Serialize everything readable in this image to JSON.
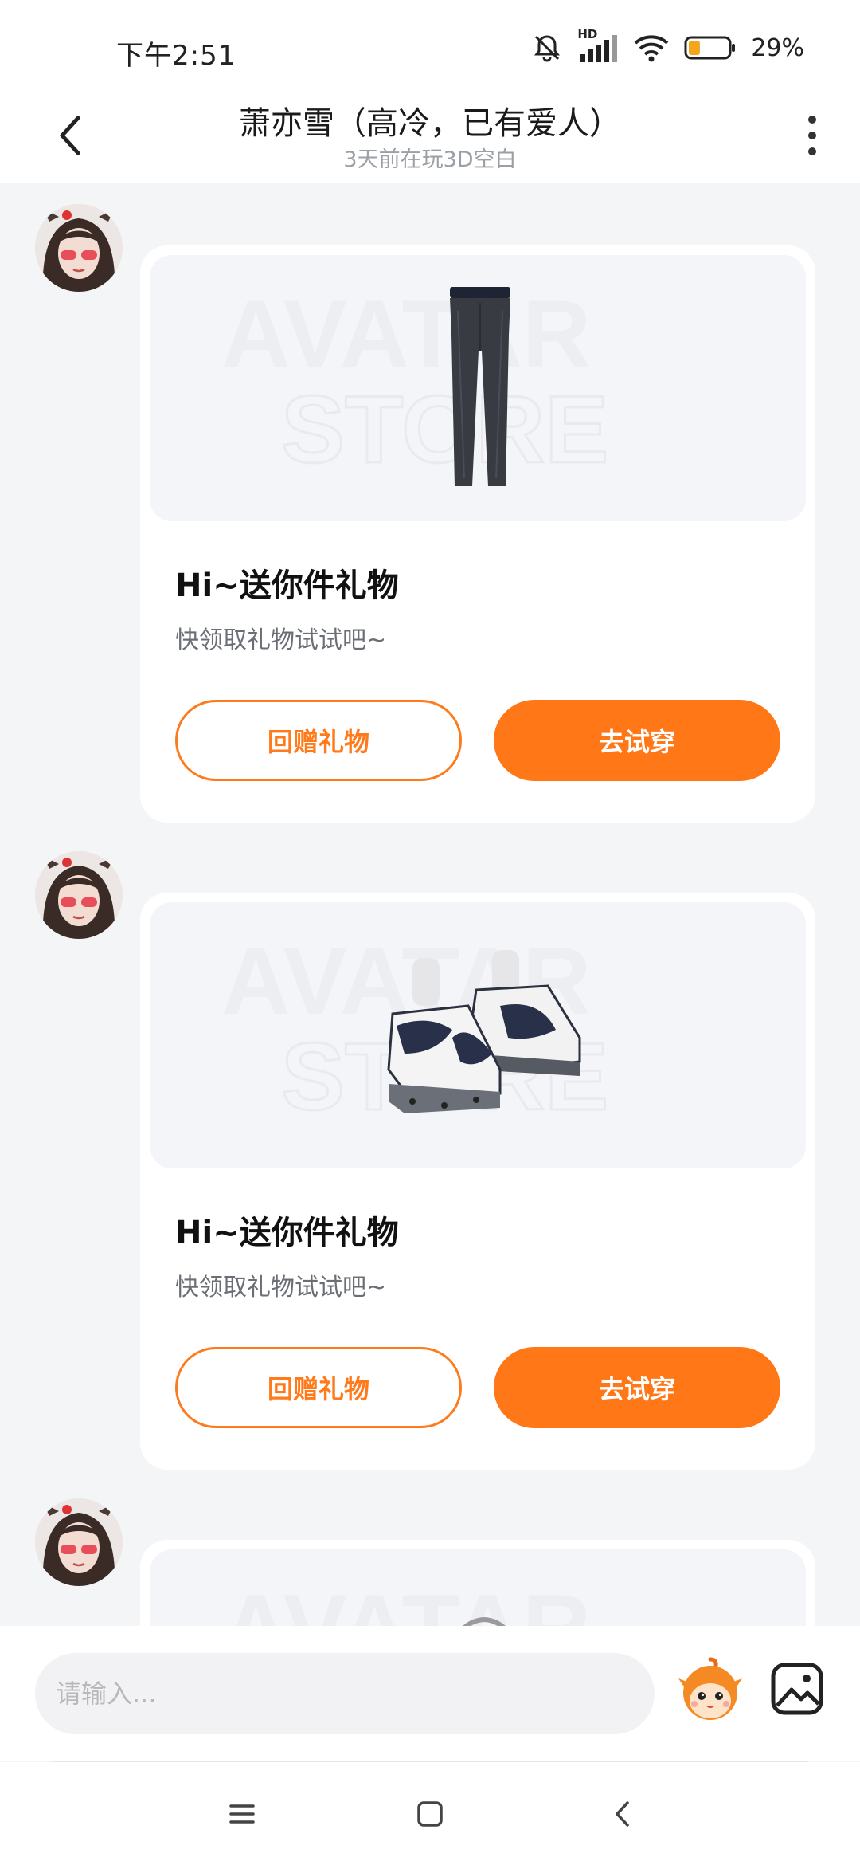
{
  "status_bar": {
    "time": "下午2:51",
    "network_label": "HD",
    "battery_percent": "29%",
    "battery_level": 0.29,
    "icons": [
      "bell-mute-icon",
      "signal-icon",
      "wifi-icon",
      "battery-icon"
    ]
  },
  "header": {
    "title": "萧亦雪（高冷，已有爱人）",
    "subtitle": "3天前在玩3D空白",
    "icons": [
      "back-icon",
      "more-vertical-icon"
    ]
  },
  "messages": [
    {
      "item": "pants",
      "title": "Hi~送你件礼物",
      "subtitle": "快领取礼物试试吧~",
      "return_gift_label": "回赠礼物",
      "try_on_label": "去试穿"
    },
    {
      "item": "sneakers",
      "title": "Hi~送你件礼物",
      "subtitle": "快领取礼物试试吧~",
      "return_gift_label": "回赠礼物",
      "try_on_label": "去试穿"
    },
    {
      "item": "hair"
    }
  ],
  "input_bar": {
    "placeholder": "请输入...",
    "icons": [
      "emoji-mascot-icon",
      "image-icon"
    ]
  },
  "nav_bar": {
    "icons": [
      "menu-icon",
      "home-icon",
      "back-icon"
    ]
  },
  "colors": {
    "accent": "#ff7716",
    "background": "#f4f5f7",
    "card": "#ffffff"
  }
}
